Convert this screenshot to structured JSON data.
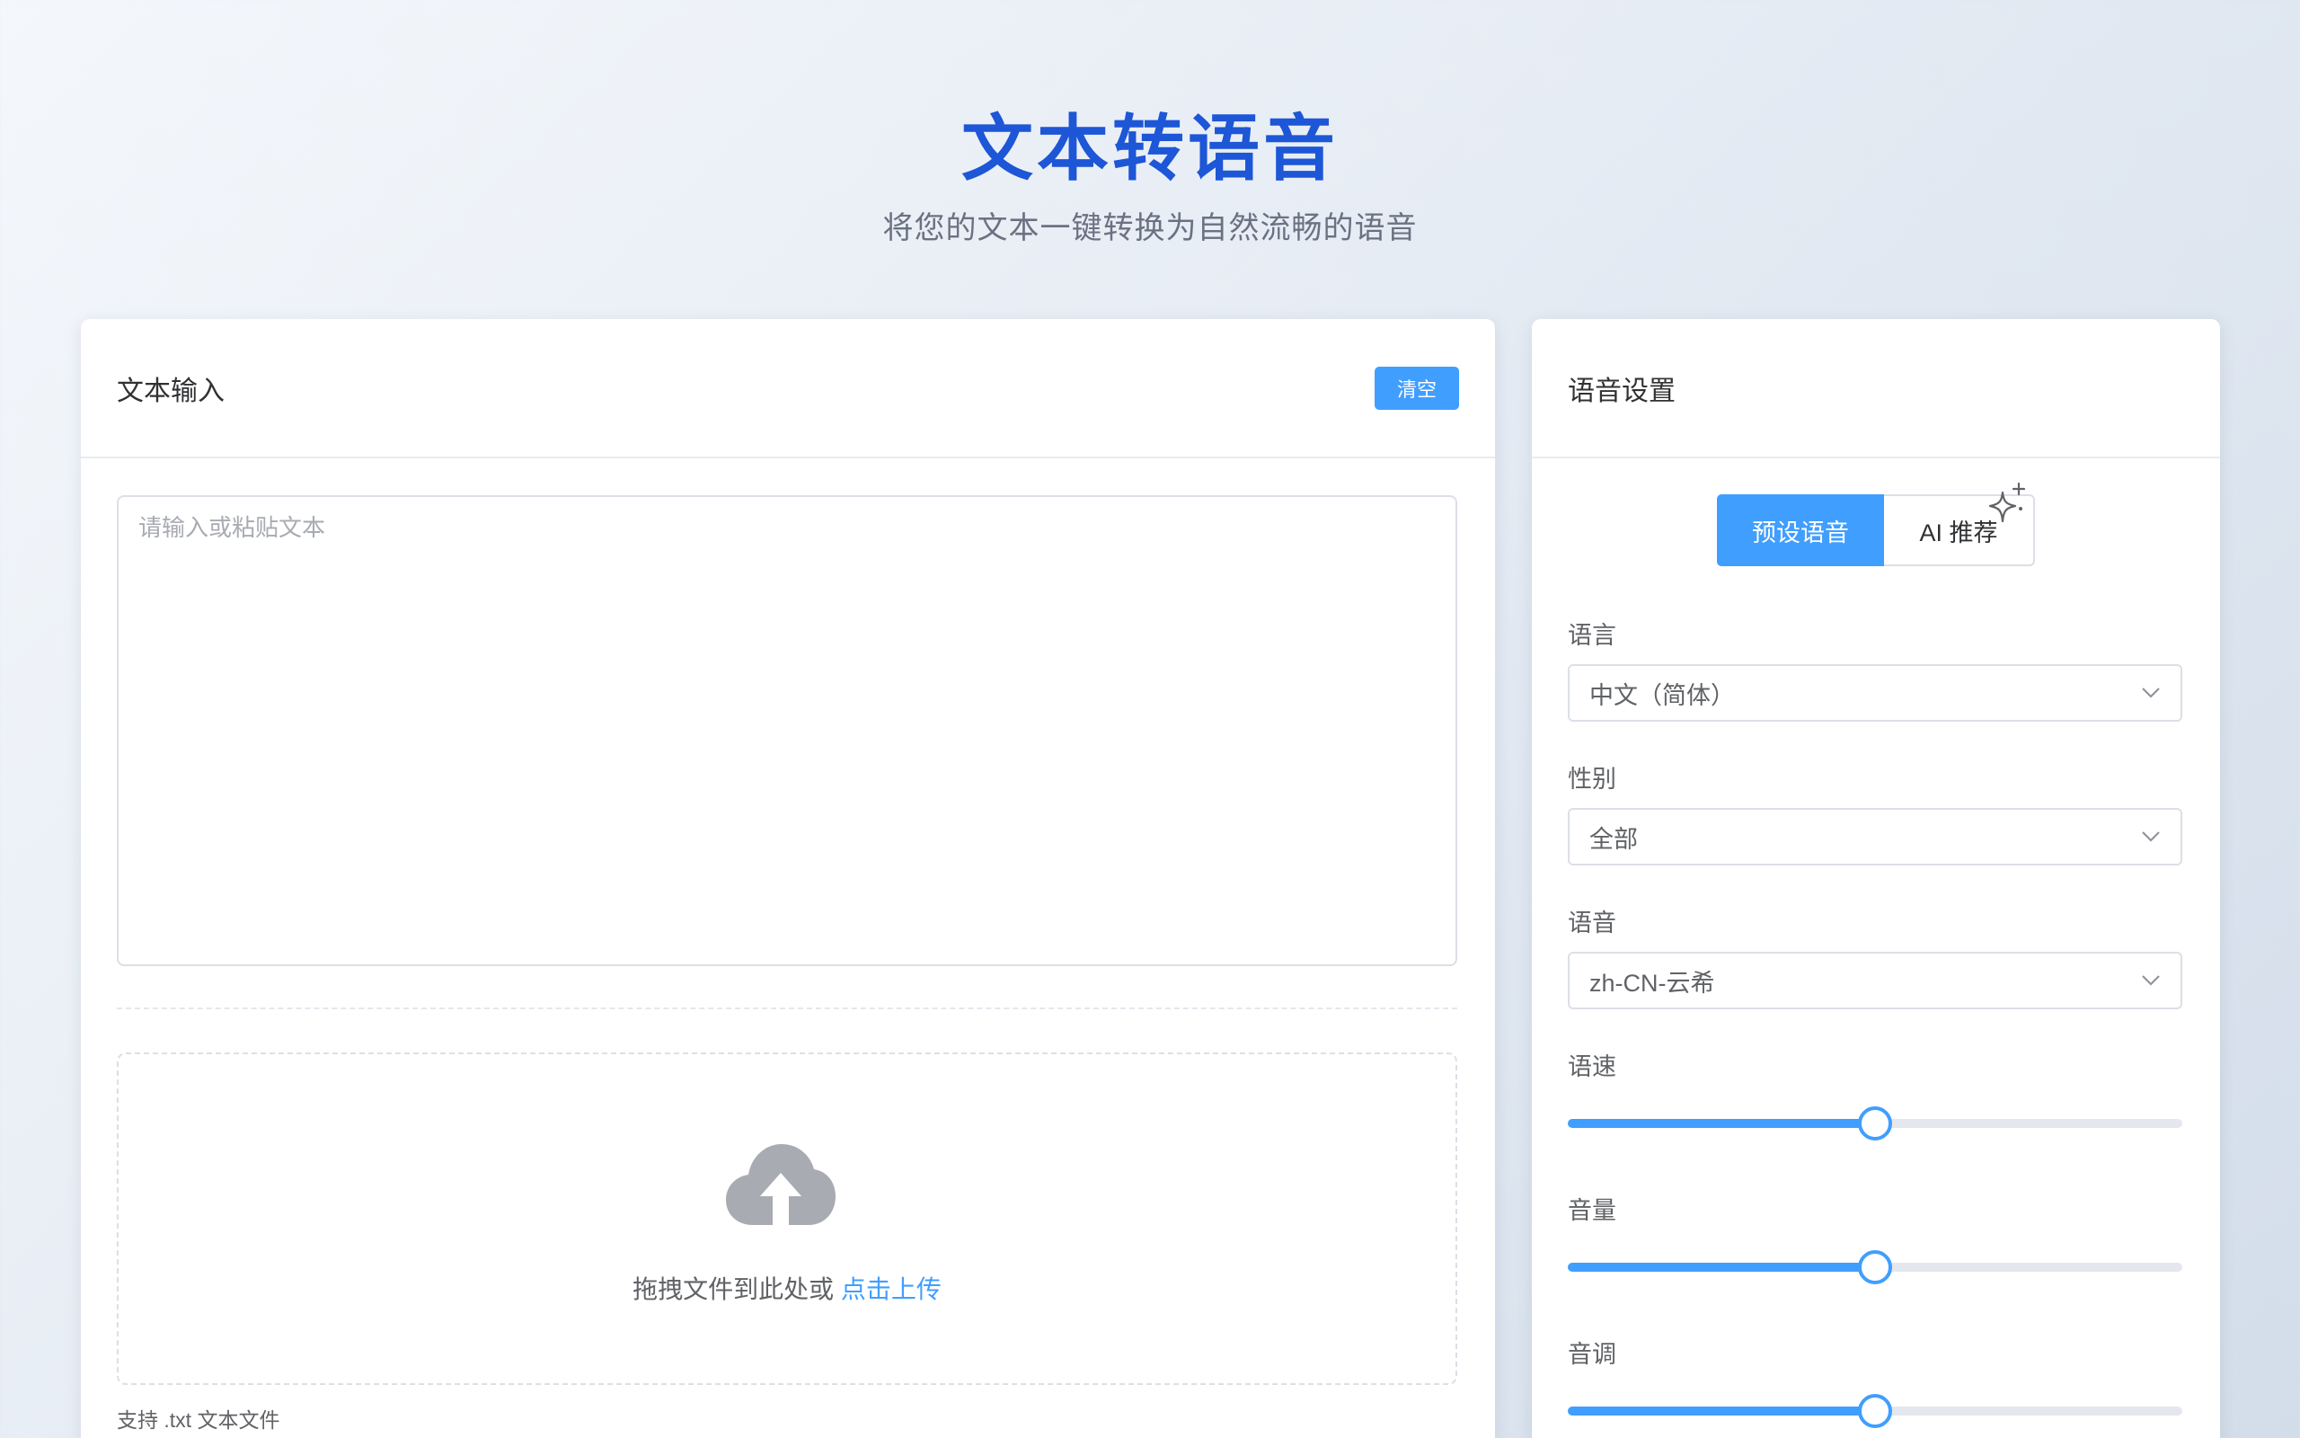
{
  "header": {
    "title": "文本转语音",
    "subtitle": "将您的文本一键转换为自然流畅的语音"
  },
  "text_panel": {
    "title": "文本输入",
    "clear_label": "清空",
    "textarea_value": "",
    "textarea_placeholder": "请输入或粘贴文本",
    "upload": {
      "icon": "cloud-upload-icon",
      "prompt": "拖拽文件到此处或",
      "link": "点击上传",
      "tip": "支持 .txt 文本文件"
    }
  },
  "voice_panel": {
    "title": "语音设置",
    "tabs": [
      {
        "label": "预设语音",
        "active": true
      },
      {
        "label": "AI 推荐",
        "active": false,
        "icon": "sparkle-icon"
      }
    ],
    "language": {
      "label": "语言",
      "value": "中文（简体）"
    },
    "gender": {
      "label": "性别",
      "value": "全部"
    },
    "voice": {
      "label": "语音",
      "value": "zh-CN-云希"
    },
    "rate": {
      "label": "语速",
      "fraction": 0.5
    },
    "volume": {
      "label": "音量",
      "fraction": 0.5
    },
    "pitch": {
      "label": "音调",
      "fraction": 0.5
    }
  },
  "colors": {
    "accent": "#409eff",
    "title": "#1d56d6"
  }
}
